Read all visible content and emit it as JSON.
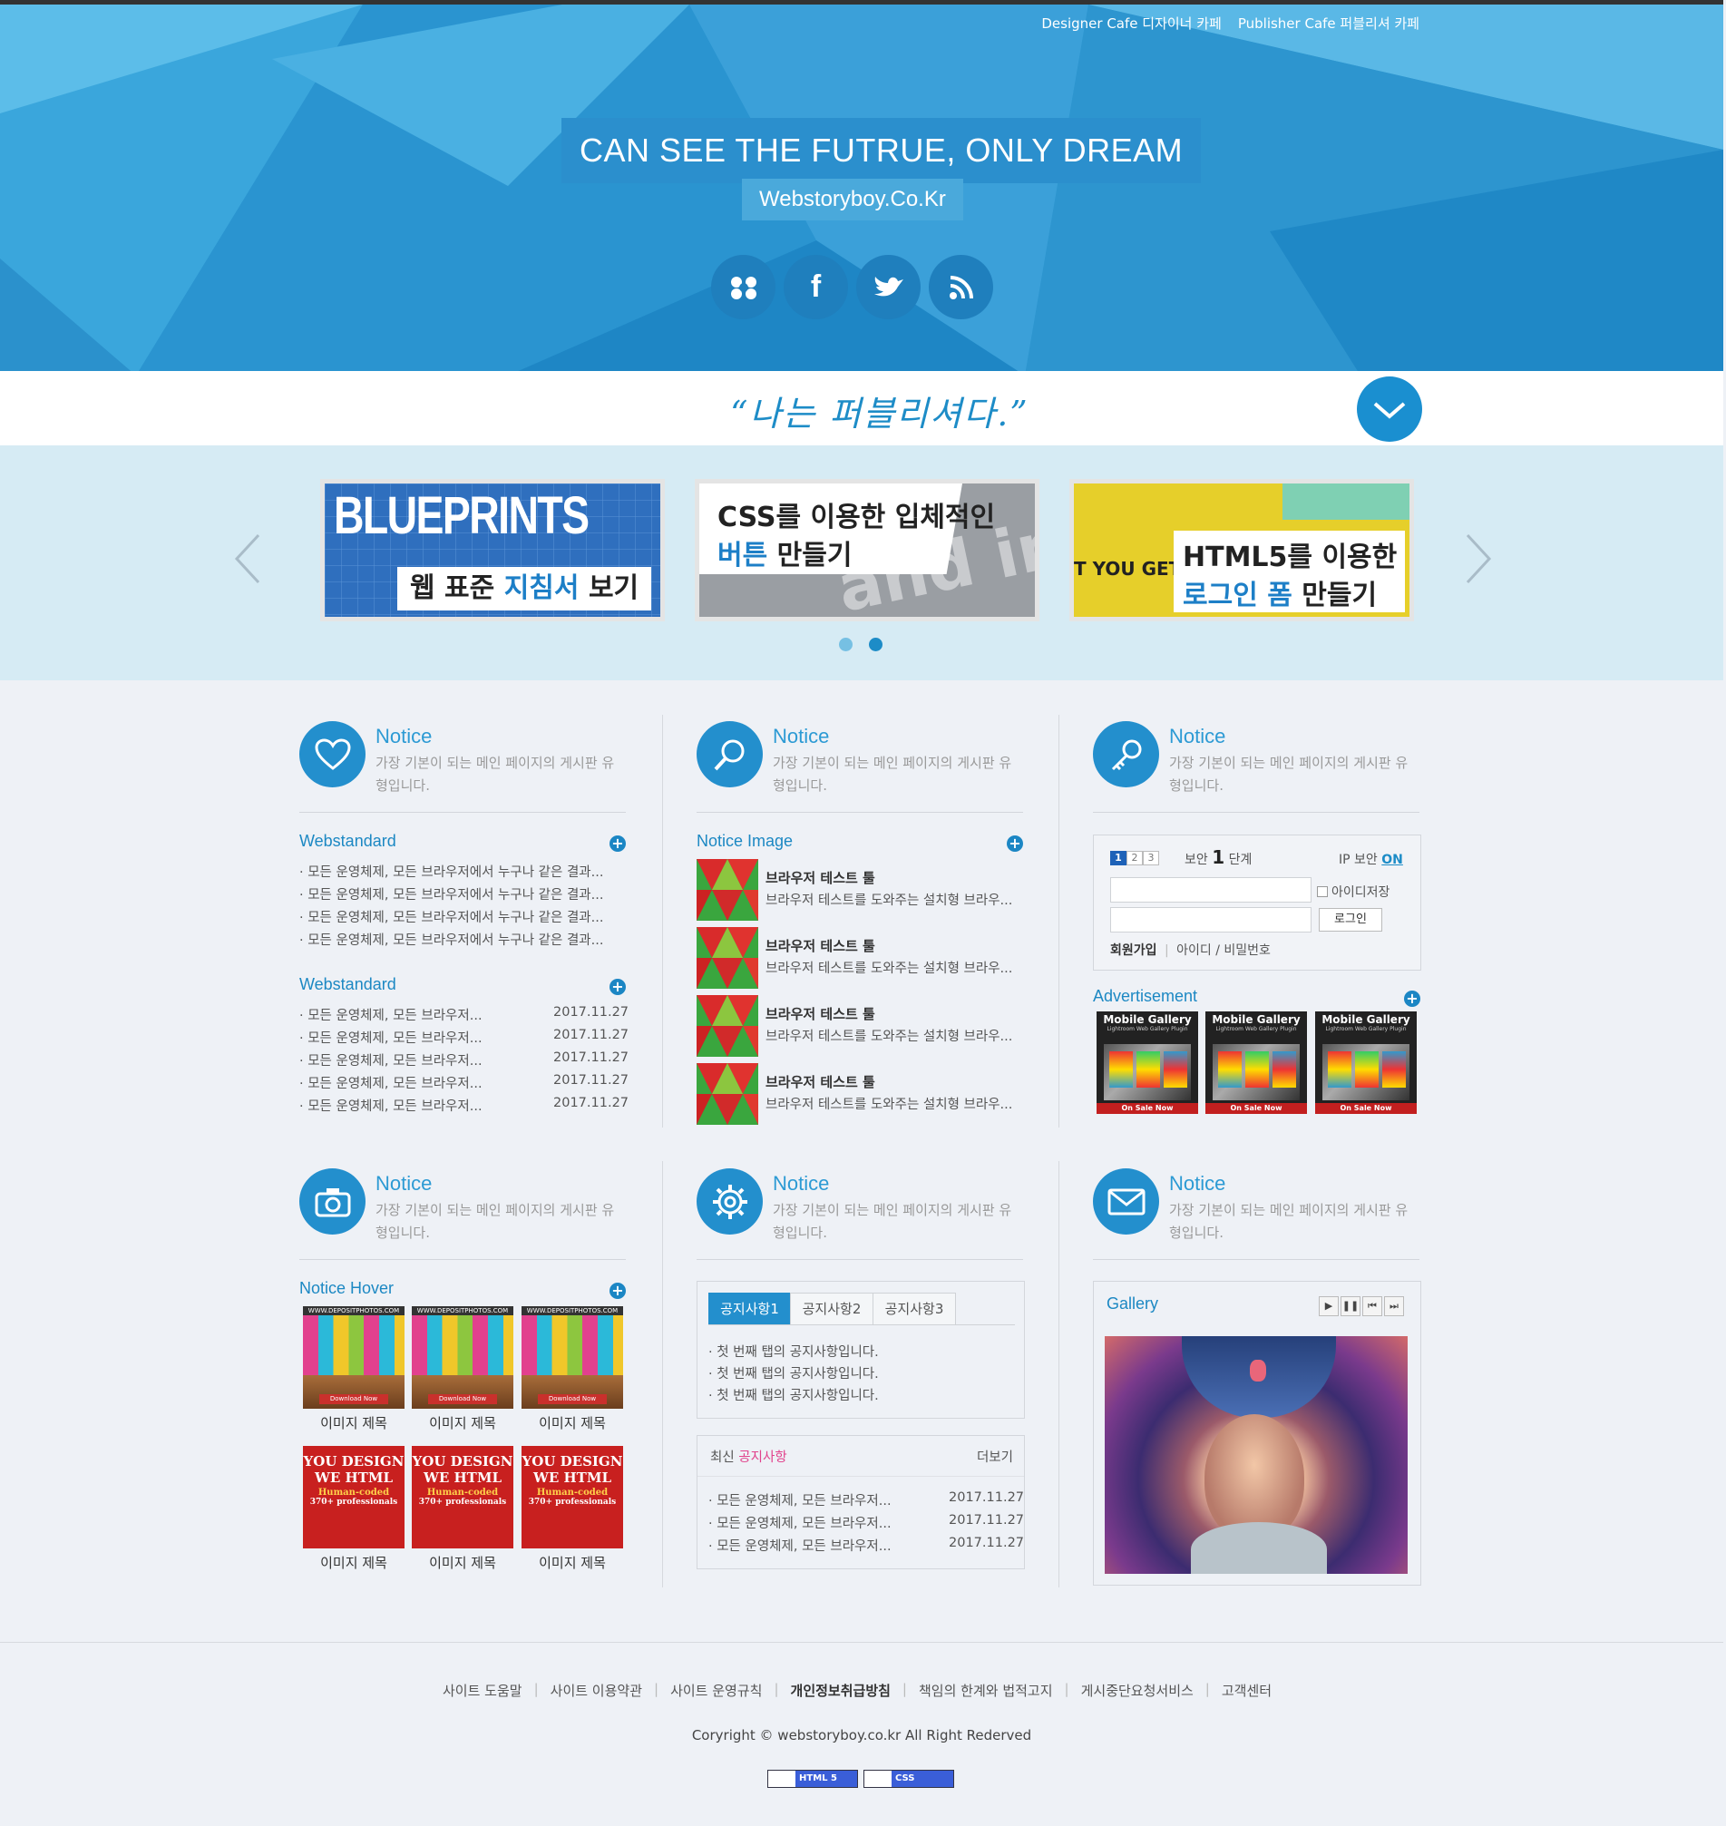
{
  "header": {
    "top_links": [
      "Designer Cafe 디자이너 카페",
      "Publisher Cafe 퍼블리셔 카페"
    ],
    "title": "CAN SEE THE FUTRUE, ONLY DREAM",
    "subtitle": "Webstoryboy.Co.Kr",
    "social": [
      "flickr-icon",
      "facebook-icon",
      "twitter-icon",
      "rss-icon"
    ]
  },
  "slogan": "“나는 퍼블리셔다.”",
  "slider": {
    "slides": [
      {
        "big": "BLUEPRINTS",
        "line1": "웹 표준 ",
        "line1_hl": "지침서",
        "line1_end": " 보기"
      },
      {
        "line1": "CSS를 이용한 입체적인",
        "line2_hl": "버튼",
        "line2_end": " 만들기",
        "bg_text": "and inte"
      },
      {
        "side": "T YOU GET",
        "line1": "HTML5를 이용한",
        "line2_hl": "로그인 폼",
        "line2_end": " 만들기"
      }
    ],
    "dots": 2,
    "active_dot": 2
  },
  "notice_title": "Notice",
  "notice_desc": "가장 기본이 되는 메인 페이지의 게시판 유형입니다.",
  "col1": {
    "webstandard_title": "Webstandard",
    "webstandard_items": [
      "· 모든 운영체제, 모든 브라우저에서 누구나 같은 결과...",
      "· 모든 운영체제, 모든 브라우저에서 누구나 같은 결과...",
      "· 모든 운영체제, 모든 브라우저에서 누구나 같은 결과...",
      "· 모든 운영체제, 모든 브라우저에서 누구나 같은 결과..."
    ],
    "webstandard2_title": "Webstandard",
    "dated_items": [
      {
        "text": "· 모든 운영체제, 모든 브라우저...",
        "date": "2017.11.27"
      },
      {
        "text": "· 모든 운영체제, 모든 브라우저...",
        "date": "2017.11.27"
      },
      {
        "text": "· 모든 운영체제, 모든 브라우저...",
        "date": "2017.11.27"
      },
      {
        "text": "· 모든 운영체제, 모든 브라우저...",
        "date": "2017.11.27"
      },
      {
        "text": "· 모든 운영체제, 모든 브라우저...",
        "date": "2017.11.27"
      }
    ],
    "hover_title": "Notice Hover",
    "hover_captions": [
      "이미지 제목",
      "이미지 제목",
      "이미지 제목",
      "이미지 제목",
      "이미지 제목",
      "이미지 제목"
    ],
    "download_label": "Download Now",
    "deposit_label": "WWW.DEPOSITPHOTOS.COM",
    "you_design": [
      "YOU DESIGN",
      "WE HTML",
      "Human-coded",
      "370+ professionals"
    ]
  },
  "col2": {
    "image_title": "Notice Image",
    "image_items": [
      {
        "title": "브라우저 테스트 툴",
        "desc": "브라우저 테스트를 도와주는 설치형 브라우..."
      },
      {
        "title": "브라우저 테스트 툴",
        "desc": "브라우저 테스트를 도와주는 설치형 브라우..."
      },
      {
        "title": "브라우저 테스트 툴",
        "desc": "브라우저 테스트를 도와주는 설치형 브라우..."
      },
      {
        "title": "브라우저 테스트 툴",
        "desc": "브라우저 테스트를 도와주는 설치형 브라우..."
      }
    ],
    "tabs": [
      "공지사항1",
      "공지사항2",
      "공지사항3"
    ],
    "tab_items": [
      "· 첫 번째 탭의 공지사항입니다.",
      "· 첫 번째 탭의 공지사항입니다.",
      "· 첫 번째 탭의 공지사항입니다."
    ],
    "latest_prefix": "최신 ",
    "latest_hl": "공지사항",
    "more": "더보기",
    "latest_items": [
      {
        "text": "· 모든 운영체제, 모든 브라우저...",
        "date": "2017.11.27"
      },
      {
        "text": "· 모든 운영체제, 모든 브라우저...",
        "date": "2017.11.27"
      },
      {
        "text": "· 모든 운영체제, 모든 브라우저...",
        "date": "2017.11.27"
      }
    ]
  },
  "col3": {
    "login": {
      "steps": [
        "1",
        "2",
        "3"
      ],
      "security_label": "보안",
      "security_level": "1",
      "security_unit": "단계",
      "ip_label": "IP 보안",
      "ip_state": "ON",
      "save_id": "아이디저장",
      "login_button": "로그인",
      "join": "회원가입",
      "find": "아이디 / 비밀번호"
    },
    "ad_title": "Advertisement",
    "ad_label": "Mobile Gallery",
    "ad_sub": "Lightroom Web Gallery Plugin",
    "ad_sale": "On Sale Now",
    "gallery_title": "Gallery",
    "gallery_controls": [
      "▶",
      "❚❚",
      "⏮",
      "⏭"
    ]
  },
  "footer": {
    "links": [
      "사이트 도움말",
      "사이트 이용약관",
      "사이트 운영규칙",
      "개인정보취급방침",
      "책임의 한계와 법적고지",
      "게시중단요청서비스",
      "고객센터"
    ],
    "copyright": "Coryright © webstoryboy.co.kr All Right Rederved",
    "badges": [
      "HTML 5",
      "CSS"
    ]
  },
  "colors": {
    "accent": "#238fcd",
    "header_bg": "#2e9ad3",
    "slider_bg": "#d6ebf4",
    "highlight_pink": "#e1428c"
  }
}
